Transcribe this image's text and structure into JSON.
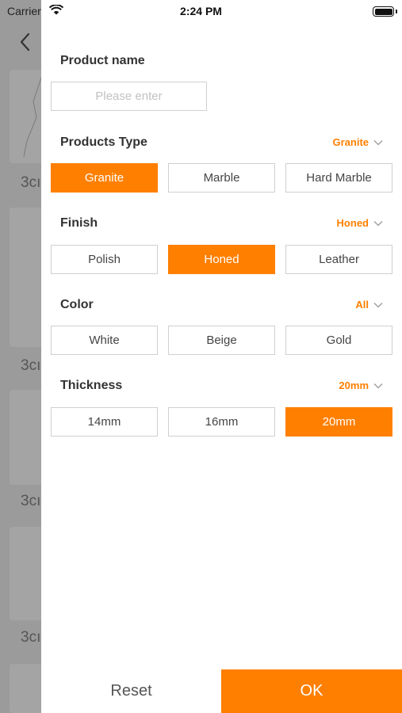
{
  "status_bar": {
    "carrier": "Carrier",
    "time": "2:24 PM"
  },
  "background": {
    "item_labels": [
      "3cı",
      "3cı",
      "3cı",
      "3cı"
    ]
  },
  "product_name": {
    "title": "Product name",
    "placeholder": "Please enter",
    "value": ""
  },
  "products_type": {
    "title": "Products Type",
    "selected": "Granite",
    "options": [
      "Granite",
      "Marble",
      "Hard Marble"
    ]
  },
  "finish": {
    "title": "Finish",
    "selected": "Honed",
    "options": [
      "Polish",
      "Honed",
      "Leather"
    ]
  },
  "color": {
    "title": "Color",
    "selected": "All",
    "options": [
      "White",
      "Beige",
      "Gold"
    ]
  },
  "thickness": {
    "title": "Thickness",
    "selected": "20mm",
    "options": [
      "14mm",
      "16mm",
      "20mm"
    ]
  },
  "footer": {
    "reset_label": "Reset",
    "ok_label": "OK"
  },
  "colors": {
    "accent": "#ff7f00",
    "border": "#cfcfcf",
    "text": "#333333"
  }
}
